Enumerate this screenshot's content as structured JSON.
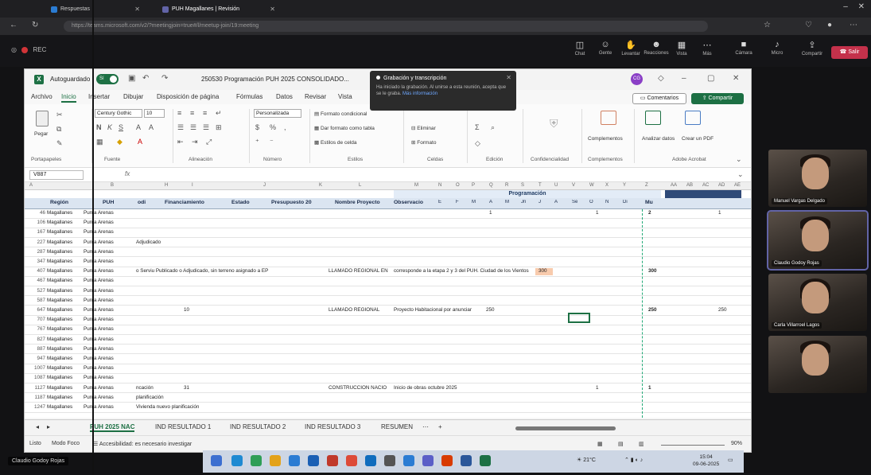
{
  "browser": {
    "tabs": [
      {
        "label": "Respuestas"
      },
      {
        "label": "PUH Magallanes | Revisión"
      }
    ],
    "url": "https://teams.microsoft.com/v2/?meetingjoin=true#/l/meetup-join/19:meeting"
  },
  "meeting": {
    "left_label": "REC",
    "tools": [
      {
        "icon": "chat-icon",
        "label": "Chat"
      },
      {
        "icon": "people-icon",
        "label": "Gente"
      },
      {
        "icon": "hand-icon",
        "label": "Levantar"
      },
      {
        "icon": "react-icon",
        "label": "Reacciones"
      },
      {
        "icon": "view-icon",
        "label": "Vista"
      },
      {
        "icon": "more-icon",
        "label": "Más"
      },
      {
        "icon": "camera-icon",
        "label": "Cámara"
      },
      {
        "icon": "mic-icon",
        "label": "Micro"
      },
      {
        "icon": "share-icon",
        "label": "Compartir"
      }
    ],
    "leave_label": "Salir"
  },
  "excel": {
    "autosave_label": "Autoguardado",
    "toggle_label": "Sí",
    "doc_title": "250530 Programación PUH 2025 CONSOLIDADO...",
    "notification": {
      "title": "Grabación y transcripción",
      "body": "Ha iniciado la grabación. Al unirse a esta reunión, acepta que se le graba.",
      "link": "Más información"
    },
    "menu": [
      "Archivo",
      "Inicio",
      "Insertar",
      "Dibujar",
      "Disposición de página",
      "Fórmulas",
      "Datos",
      "Revisar",
      "Vista"
    ],
    "active_menu": "Inicio",
    "comments_label": "Comentarios",
    "share_label": "Compartir",
    "ribbon": {
      "paste": "Pegar",
      "clipboard": "Portapapeles",
      "font_name": "Century Gothic",
      "font_size": "10",
      "font": "Fuente",
      "alignment": "Alineación",
      "number_format": "Personalizada",
      "number": "Número",
      "cond_format": "Formato condicional",
      "table_format": "Dar formato como tabla",
      "cell_styles": "Estilos de celda",
      "styles": "Estilos",
      "delete": "Eliminar",
      "format": "Formato",
      "cells": "Celdas",
      "editing": "Edición",
      "sensitivity": "Confidencialidad",
      "addins_btn": "Complementos",
      "addins": "Complementos",
      "analyze": "Analizar datos",
      "create_pdf": "Crear un PDF",
      "adobe": "Adobe Acrobat"
    },
    "name_box": "V887",
    "fx": "fx",
    "col_letters": [
      "A",
      "B",
      "H",
      "I",
      "J",
      "K",
      "L",
      "M",
      "N",
      "O",
      "P",
      "Q",
      "R",
      "S",
      "T",
      "U",
      "V",
      "W",
      "X",
      "Y",
      "Z",
      "AA",
      "AB",
      "AC",
      "AD",
      "AE"
    ],
    "programacion_label": "Programación",
    "headers": {
      "region": "Región",
      "puh": "PUH",
      "odi": "odi",
      "financiamiento": "Financiamiento",
      "estado": "Estado",
      "presupuesto": "Presupuesto 20",
      "nombre": "Nombre Proyecto",
      "observacion": "Observacio",
      "months": [
        "E",
        "F",
        "M",
        "A",
        "M",
        "Jn",
        "J",
        "A",
        "Se",
        "O",
        "N",
        "Di"
      ],
      "total": "Mu"
    },
    "rows": [
      {
        "n": "46",
        "r": "Magallanes",
        "p": "Punta Arenas",
        "c": "",
        "f": "",
        "nm": "",
        "ob": "",
        "v1": "1",
        "v2": "1",
        "t": "2",
        "end": "1"
      },
      {
        "n": "106",
        "r": "Magallanes",
        "p": "Punta Arenas",
        "c": "",
        "f": "",
        "nm": "",
        "ob": "",
        "v1": "",
        "v2": "",
        "t": "",
        "end": ""
      },
      {
        "n": "167",
        "r": "Magallanes",
        "p": "Punta Arenas",
        "c": "",
        "f": "",
        "nm": "",
        "ob": "",
        "v1": "",
        "v2": "",
        "t": "",
        "end": ""
      },
      {
        "n": "227",
        "r": "Magallanes",
        "p": "Punta Arenas",
        "c": "Adjudicado",
        "f": "",
        "nm": "",
        "ob": "",
        "v1": "",
        "v2": "",
        "t": "",
        "end": ""
      },
      {
        "n": "287",
        "r": "Magallanes",
        "p": "Punta Arenas",
        "c": "",
        "f": "",
        "nm": "",
        "ob": "",
        "v1": "",
        "v2": "",
        "t": "",
        "end": ""
      },
      {
        "n": "347",
        "r": "Magallanes",
        "p": "Punta Arenas",
        "c": "",
        "f": "",
        "nm": "",
        "ob": "",
        "v1": "",
        "v2": "",
        "t": "",
        "end": ""
      },
      {
        "n": "407",
        "r": "Magallanes",
        "p": "Punta Arenas",
        "c": "o Serviu Publicado o Adjudicado, sin terreno asignado a EP",
        "f": "",
        "nm": "LLAMADO REGIONAL EN",
        "ob": "corresponde a la etapa 2 y 3 del PUH. Ciudad de los Vientos",
        "v1": "300",
        "v2": "",
        "t": "300",
        "end": ""
      },
      {
        "n": "467",
        "r": "Magallanes",
        "p": "Punta Arenas",
        "c": "",
        "f": "",
        "nm": "",
        "ob": "",
        "v1": "",
        "v2": "",
        "t": "",
        "end": ""
      },
      {
        "n": "527",
        "r": "Magallanes",
        "p": "Punta Arenas",
        "c": "",
        "f": "",
        "nm": "",
        "ob": "",
        "v1": "",
        "v2": "",
        "t": "",
        "end": ""
      },
      {
        "n": "587",
        "r": "Magallanes",
        "p": "Punta Arenas",
        "c": "",
        "f": "",
        "nm": "",
        "ob": "",
        "v1": "",
        "v2": "",
        "t": "",
        "end": ""
      },
      {
        "n": "647",
        "r": "Magallanes",
        "p": "Punta Arenas",
        "c": "",
        "f": "10",
        "nm": "LLAMADO REGIONAL",
        "ob": "Proyecto Habitacional por anunciar",
        "v1": "250",
        "v2": "",
        "t": "250",
        "end": "250"
      },
      {
        "n": "707",
        "r": "Magallanes",
        "p": "Punta Arenas",
        "c": "",
        "f": "",
        "nm": "",
        "ob": "",
        "v1": "",
        "v2": "",
        "t": "",
        "end": ""
      },
      {
        "n": "767",
        "r": "Magallanes",
        "p": "Punta Arenas",
        "c": "",
        "f": "",
        "nm": "",
        "ob": "",
        "v1": "",
        "v2": "",
        "t": "",
        "end": ""
      },
      {
        "n": "827",
        "r": "Magallanes",
        "p": "Punta Arenas",
        "c": "",
        "f": "",
        "nm": "",
        "ob": "",
        "v1": "",
        "v2": "",
        "t": "",
        "end": ""
      },
      {
        "n": "887",
        "r": "Magallanes",
        "p": "Punta Arenas",
        "c": "",
        "f": "",
        "nm": "",
        "ob": "",
        "v1": "",
        "v2": "",
        "t": "",
        "end": ""
      },
      {
        "n": "947",
        "r": "Magallanes",
        "p": "Punta Arenas",
        "c": "",
        "f": "",
        "nm": "",
        "ob": "",
        "v1": "",
        "v2": "",
        "t": "",
        "end": ""
      },
      {
        "n": "1007",
        "r": "Magallanes",
        "p": "Punta Arenas",
        "c": "",
        "f": "",
        "nm": "",
        "ob": "",
        "v1": "",
        "v2": "",
        "t": "",
        "end": ""
      },
      {
        "n": "1087",
        "r": "Magallanes",
        "p": "Punta Arenas",
        "c": "",
        "f": "",
        "nm": "",
        "ob": "",
        "v1": "",
        "v2": "",
        "t": "",
        "end": ""
      },
      {
        "n": "1127",
        "r": "Magallanes",
        "p": "Punta Arenas",
        "c": "ncación",
        "f": "31",
        "nm": "CONSTRUCCIÓN NACIO",
        "ob": "Inicio de obras octubre 2025",
        "v1": "",
        "v2": "1",
        "t": "1",
        "end": ""
      },
      {
        "n": "1187",
        "r": "Magallanes",
        "p": "Punta Arenas",
        "c": "planificación",
        "f": "",
        "nm": "",
        "ob": "",
        "v1": "",
        "v2": "",
        "t": "",
        "end": ""
      },
      {
        "n": "1247",
        "r": "Magallanes",
        "p": "Punta Arenas",
        "c": "Vivienda nuevo planificación",
        "f": "",
        "nm": "",
        "ob": "",
        "v1": "",
        "v2": "",
        "t": "",
        "end": ""
      }
    ],
    "sheet_tabs": [
      "PUH 2025 NAC",
      "IND RESULTADO 1",
      "IND RESULTADO 2",
      "IND RESULTADO 3",
      "RESUMEN"
    ],
    "active_sheet": "PUH 2025 NAC",
    "status": {
      "ready": "Listo",
      "focus": "Modo Foco",
      "accessibility": "Accesibilidad: es necesario investigar",
      "zoom": "90%"
    }
  },
  "participants": [
    {
      "name": "Manuel Vargas Delgado"
    },
    {
      "name": "Claudio Godoy Rojas"
    },
    {
      "name": "Carla Villarroel Lagos"
    },
    {
      "name": ""
    }
  ],
  "taskbar": {
    "weather": "21°C",
    "time": "15:04",
    "date": "09-06-2025",
    "presenter": "Claudio Godoy Rojas"
  }
}
